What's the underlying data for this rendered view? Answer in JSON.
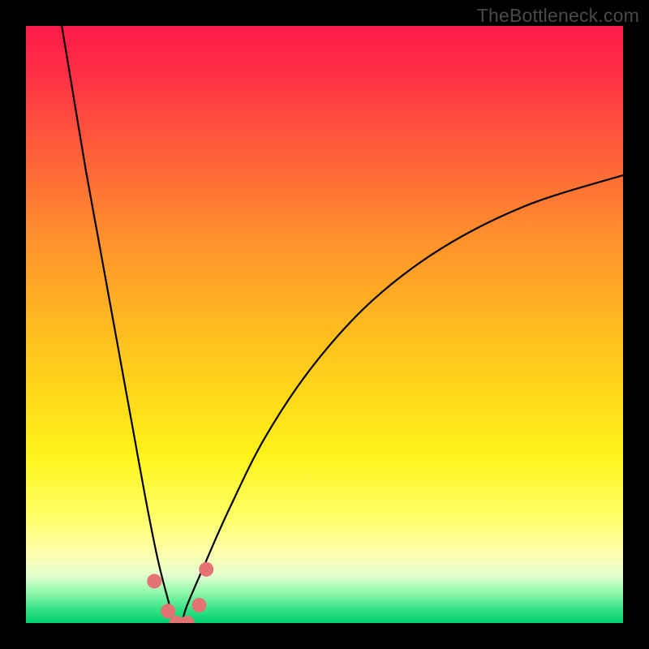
{
  "watermark": "TheBottleneck.com",
  "chart_data": {
    "type": "line",
    "title": "",
    "xlabel": "",
    "ylabel": "",
    "xlim": [
      0,
      100
    ],
    "ylim": [
      0,
      100
    ],
    "grid": false,
    "background_gradient": {
      "top": "#ff1a4a",
      "upper_mid": "#ffb421",
      "lower_mid": "#ffff66",
      "bottom": "#00d070"
    },
    "series": [
      {
        "name": "bottleneck-curve",
        "color": "#000000",
        "x": [
          6,
          8,
          10,
          12,
          14,
          16,
          18,
          20,
          22,
          23.5,
          25,
          26,
          27,
          30,
          34,
          40,
          48,
          58,
          70,
          84,
          100
        ],
        "y": [
          100,
          88,
          76,
          65,
          54,
          43,
          32,
          21,
          11,
          5,
          0,
          0,
          3,
          10,
          19,
          31,
          43,
          54,
          63,
          70,
          75
        ]
      }
    ],
    "markers": [
      {
        "name": "marker-left-shoulder",
        "x": 21.5,
        "y": 7,
        "color": "#e57373",
        "r": 9
      },
      {
        "name": "marker-left-low",
        "x": 23.8,
        "y": 2,
        "color": "#e57373",
        "r": 9
      },
      {
        "name": "marker-bottom-1",
        "x": 25.2,
        "y": 0,
        "color": "#e57373",
        "r": 9
      },
      {
        "name": "marker-bottom-2",
        "x": 27.0,
        "y": 0,
        "color": "#e57373",
        "r": 9
      },
      {
        "name": "marker-right-low",
        "x": 29.0,
        "y": 3,
        "color": "#e57373",
        "r": 9
      },
      {
        "name": "marker-right-shoulder",
        "x": 30.2,
        "y": 9,
        "color": "#e57373",
        "r": 9
      }
    ]
  }
}
